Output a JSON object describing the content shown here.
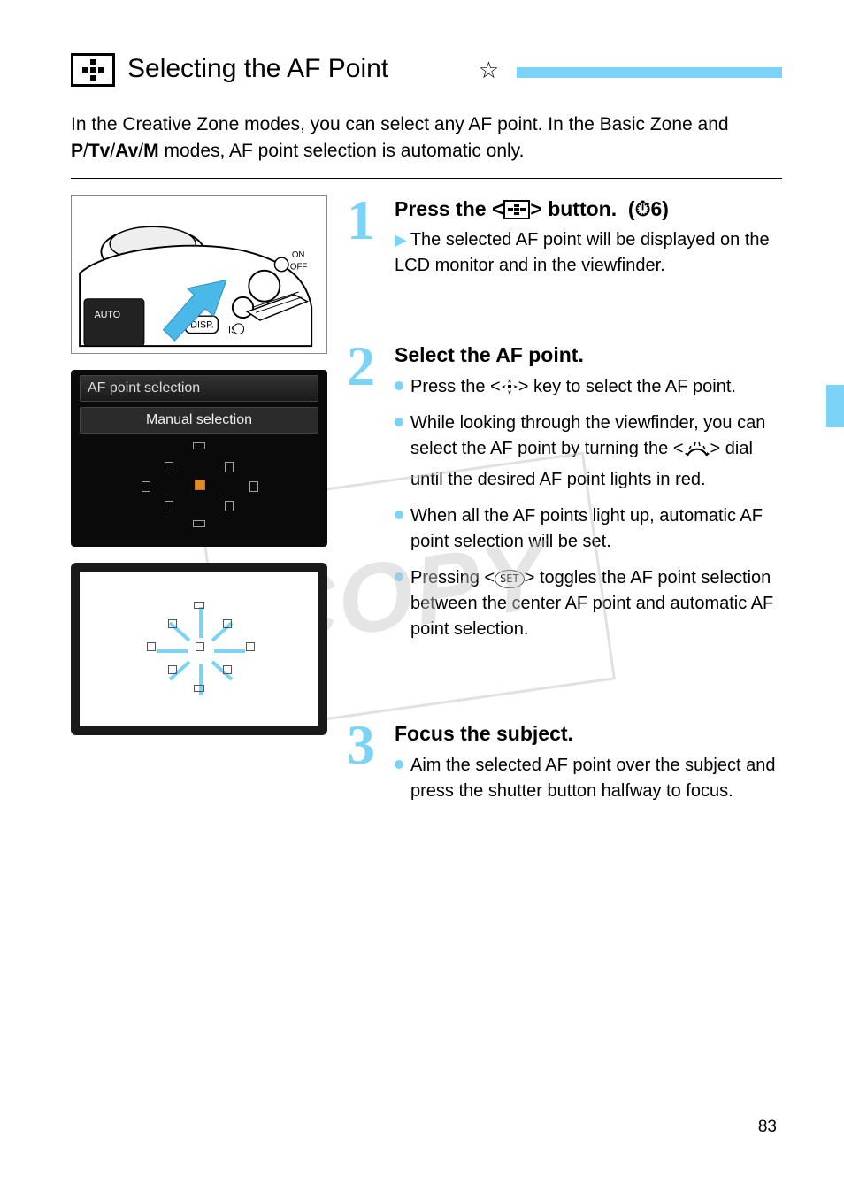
{
  "title": {
    "main": "Selecting the AF Point",
    "star": "☆"
  },
  "intro": {
    "line1_prefix": "In the Creative Zone modes, you can select any AF point. In the Basic Zone and ",
    "line1_modes": "<⁠P⁠/⁠Tv⁠/⁠Av⁠/⁠M⁠>",
    "line1_suffix": " modes, AF point selection is automatic only."
  },
  "step1": {
    "title_prefix": "Press the <",
    "title_suffix": "> button.",
    "timer": "(⏱6)",
    "tip": "The selected AF point will be displayed on the LCD monitor and in the viewfinder."
  },
  "lcd": {
    "title": "AF point selection",
    "subtitle": "Manual selection"
  },
  "step2": {
    "title": "Select the AF point.",
    "b1_a": "Press the <",
    "b1_b": "> key to select the AF point.",
    "b2": "While looking through the viewfinder, you can select the AF point by turning the <",
    "b2_suffix": "> dial until the desired AF point lights in red.",
    "b3": "When all the AF points light up, automatic AF point selection will be set.",
    "b4_a": "Pressing <",
    "b4_b": "> toggles the AF point selection between the center AF point and automatic AF point selection."
  },
  "step3": {
    "title": "Focus the subject.",
    "b1": "Aim the selected AF point over the subject and press the shutter button halfway to focus."
  },
  "page_number": "83"
}
